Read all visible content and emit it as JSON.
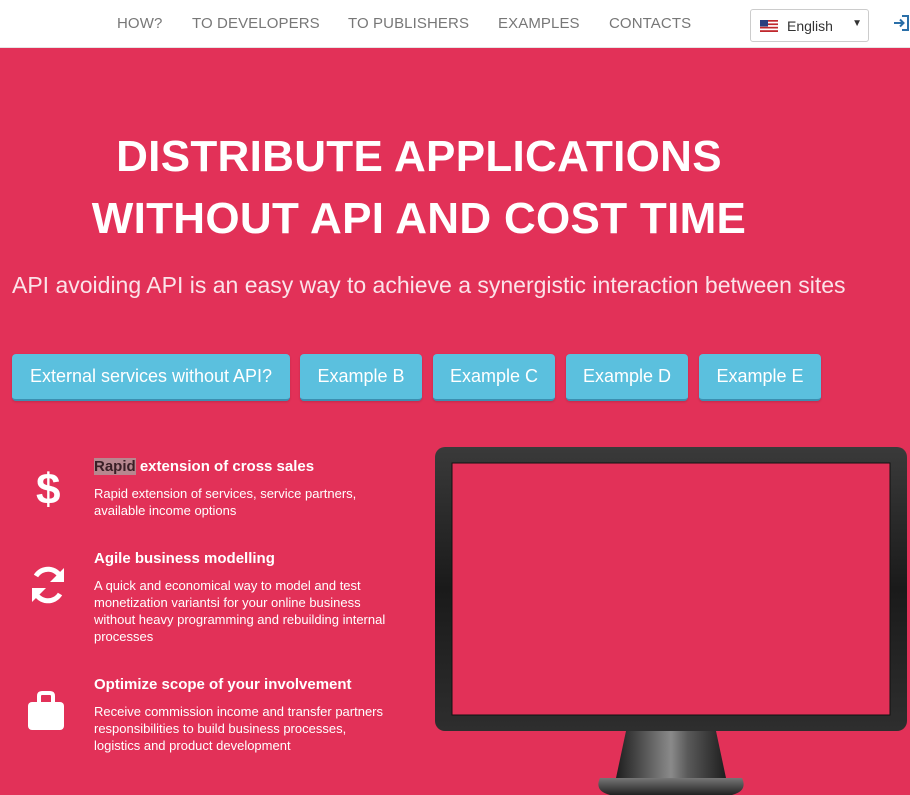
{
  "nav": {
    "links": [
      "HOW?",
      "TO DEVELOPERS",
      "TO PUBLISHERS",
      "EXAMPLES",
      "CONTACTS"
    ],
    "language": "English",
    "caret": "▼"
  },
  "hero": {
    "title_line1": "DISTRIBUTE APPLICATIONS",
    "title_line2": "WITHOUT API AND COST TIME",
    "subtitle": "API avoiding API is an easy way to achieve a synergistic interaction between sites"
  },
  "buttons": [
    "External services without API?",
    "Example B",
    "Example C",
    "Example D",
    "Example E"
  ],
  "features": [
    {
      "icon": "dollar-icon",
      "title_highlight": "Rapid",
      "title_rest": " extension of cross sales",
      "desc": "Rapid extension of services, service partners, available income options"
    },
    {
      "icon": "refresh-icon",
      "title": "Agile business modelling",
      "desc": "A quick and economical way to model and test monetization variantsi for your online business without heavy programming and rebuilding internal processes"
    },
    {
      "icon": "briefcase-icon",
      "title": "Optimize scope of your involvement",
      "desc": "Receive commission income and transfer partners responsibilities to build business processes, logistics and product development"
    }
  ],
  "colors": {
    "background": "#e23158",
    "button": "#5bc0de",
    "navbar": "#ffffff",
    "nav_text": "#777777"
  }
}
